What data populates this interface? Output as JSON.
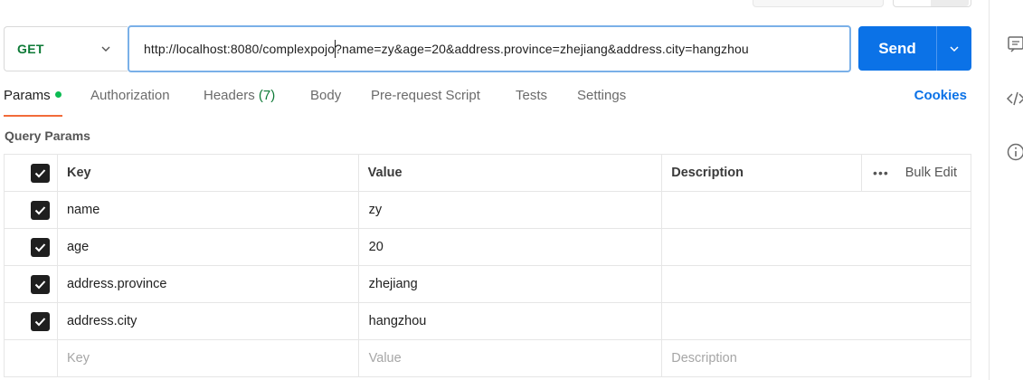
{
  "request": {
    "method": "GET",
    "url": "http://localhost:8080/complexpojo?name=zy&age=20&address.province=zhejiang&address.city=hangzhou",
    "send_label": "Send"
  },
  "tabs": [
    {
      "label": "Params",
      "badge_dot": true
    },
    {
      "label": "Authorization"
    },
    {
      "label": "Headers",
      "count": "(7)"
    },
    {
      "label": "Body"
    },
    {
      "label": "Pre-request Script"
    },
    {
      "label": "Tests"
    },
    {
      "label": "Settings"
    }
  ],
  "cookies_label": "Cookies",
  "query_params": {
    "title": "Query Params",
    "headers": {
      "key": "Key",
      "value": "Value",
      "description": "Description",
      "bulk_edit": "Bulk Edit",
      "more": "•••"
    },
    "rows": [
      {
        "checked": true,
        "key": "name",
        "value": "zy",
        "description": ""
      },
      {
        "checked": true,
        "key": "age",
        "value": "20",
        "description": ""
      },
      {
        "checked": true,
        "key": "address.province",
        "value": "zhejiang",
        "description": ""
      },
      {
        "checked": true,
        "key": "address.city",
        "value": "hangzhou",
        "description": ""
      }
    ],
    "placeholders": {
      "key": "Key",
      "value": "Value",
      "description": "Description"
    }
  },
  "right_rail": {
    "icons": [
      "comment-icon",
      "code-icon",
      "info-icon"
    ]
  },
  "colors": {
    "accent": "#0b72e7",
    "method_get": "#0e7a37",
    "tab_underline": "#f26b3a",
    "status_dot": "#0cbb52"
  }
}
